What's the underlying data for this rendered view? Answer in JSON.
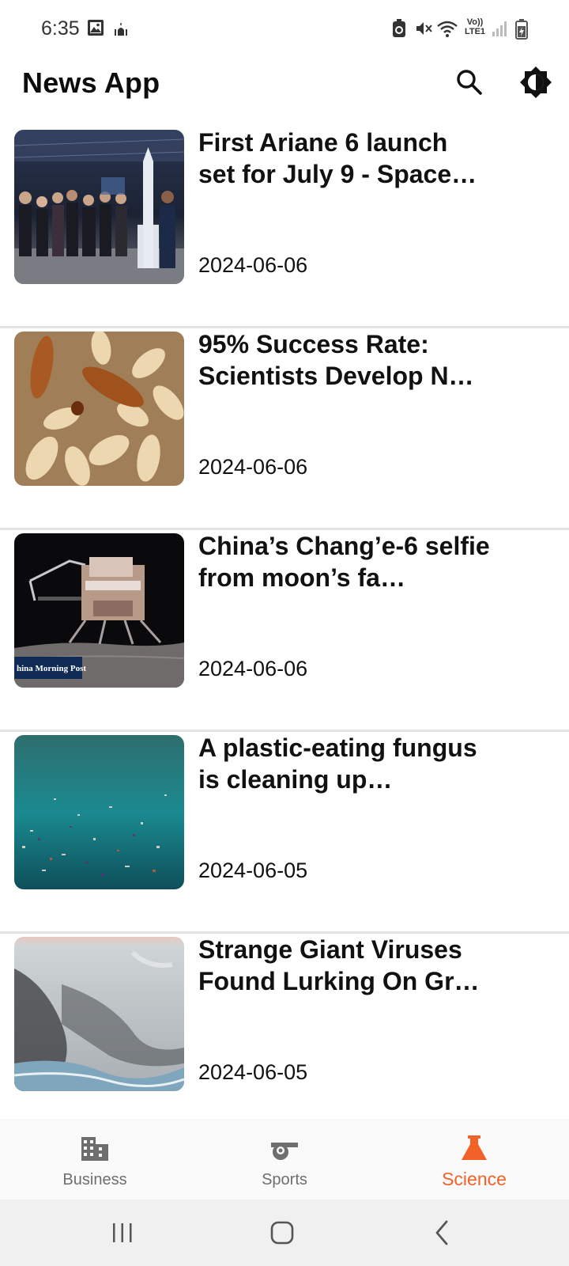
{
  "status_bar": {
    "time": "6:35",
    "left_icons": [
      "gallery-icon",
      "mosque-icon"
    ],
    "right_icons": [
      "battery-saver-icon",
      "mute-icon",
      "wifi-icon",
      "volte-icon",
      "signal-icon",
      "battery-icon"
    ],
    "volte_label": "Vo))",
    "lte_label": "LTE1"
  },
  "app_bar": {
    "title": "News App",
    "actions": [
      "search-icon",
      "brightness-icon"
    ]
  },
  "articles": [
    {
      "title": "First Ariane 6 launch set for July 9 - Space…",
      "date": "2024-06-06",
      "image": "rocket-press-photo"
    },
    {
      "title": "95% Success Rate: Scientists Develop N…",
      "date": "2024-06-06",
      "image": "termites-photo"
    },
    {
      "title": "China’s Chang’e-6 selfie from moon’s fa…",
      "date": "2024-06-06",
      "image": "lunar-lander-photo",
      "image_caption": "hina Morning Post"
    },
    {
      "title": "A plastic-eating fungus is cleaning up…",
      "date": "2024-06-05",
      "image": "ocean-plastic-photo"
    },
    {
      "title": "Strange Giant Viruses Found Lurking On Gr…",
      "date": "2024-06-05",
      "image": "greenland-ice-photo"
    }
  ],
  "bottom_nav": {
    "items": [
      {
        "label": "Business",
        "icon": "building-icon",
        "active": false
      },
      {
        "label": "Sports",
        "icon": "whistle-icon",
        "active": false
      },
      {
        "label": "Science",
        "icon": "flask-icon",
        "active": true
      }
    ]
  },
  "system_nav": [
    "recent-apps-icon",
    "home-icon",
    "back-icon"
  ],
  "colors": {
    "accent": "#f26127",
    "inactive": "#6e6e6e",
    "divider": "#e3e3e3",
    "text": "#111111",
    "background": "#ffffff"
  }
}
